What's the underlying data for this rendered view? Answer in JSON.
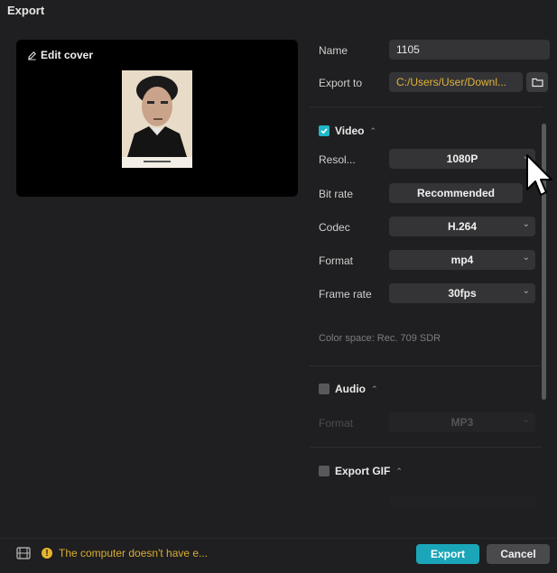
{
  "window": {
    "title": "Export"
  },
  "cover": {
    "edit_label": "Edit cover"
  },
  "settings": {
    "name": {
      "label": "Name",
      "value": "1105"
    },
    "export_to": {
      "label": "Export to",
      "value": "C:/Users/User/Downl..."
    }
  },
  "video": {
    "section_label": "Video",
    "checked": true,
    "resolution": {
      "label": "Resol...",
      "value": "1080P"
    },
    "bit_rate": {
      "label": "Bit rate",
      "value": "Recommended"
    },
    "codec": {
      "label": "Codec",
      "value": "H.264"
    },
    "format": {
      "label": "Format",
      "value": "mp4"
    },
    "frame_rate": {
      "label": "Frame rate",
      "value": "30fps"
    },
    "color_space": "Color space: Rec. 709 SDR"
  },
  "audio": {
    "section_label": "Audio",
    "checked": false,
    "format": {
      "label": "Format",
      "value": "MP3"
    }
  },
  "gif": {
    "section_label": "Export GIF",
    "checked": false
  },
  "footer": {
    "warning": "The computer doesn't have e...",
    "export_label": "Export",
    "cancel_label": "Cancel"
  },
  "colors": {
    "accent": "#1aa6b8",
    "warning": "#d9ad2f",
    "path": "#e0b23a",
    "background": "#1f1f21"
  }
}
